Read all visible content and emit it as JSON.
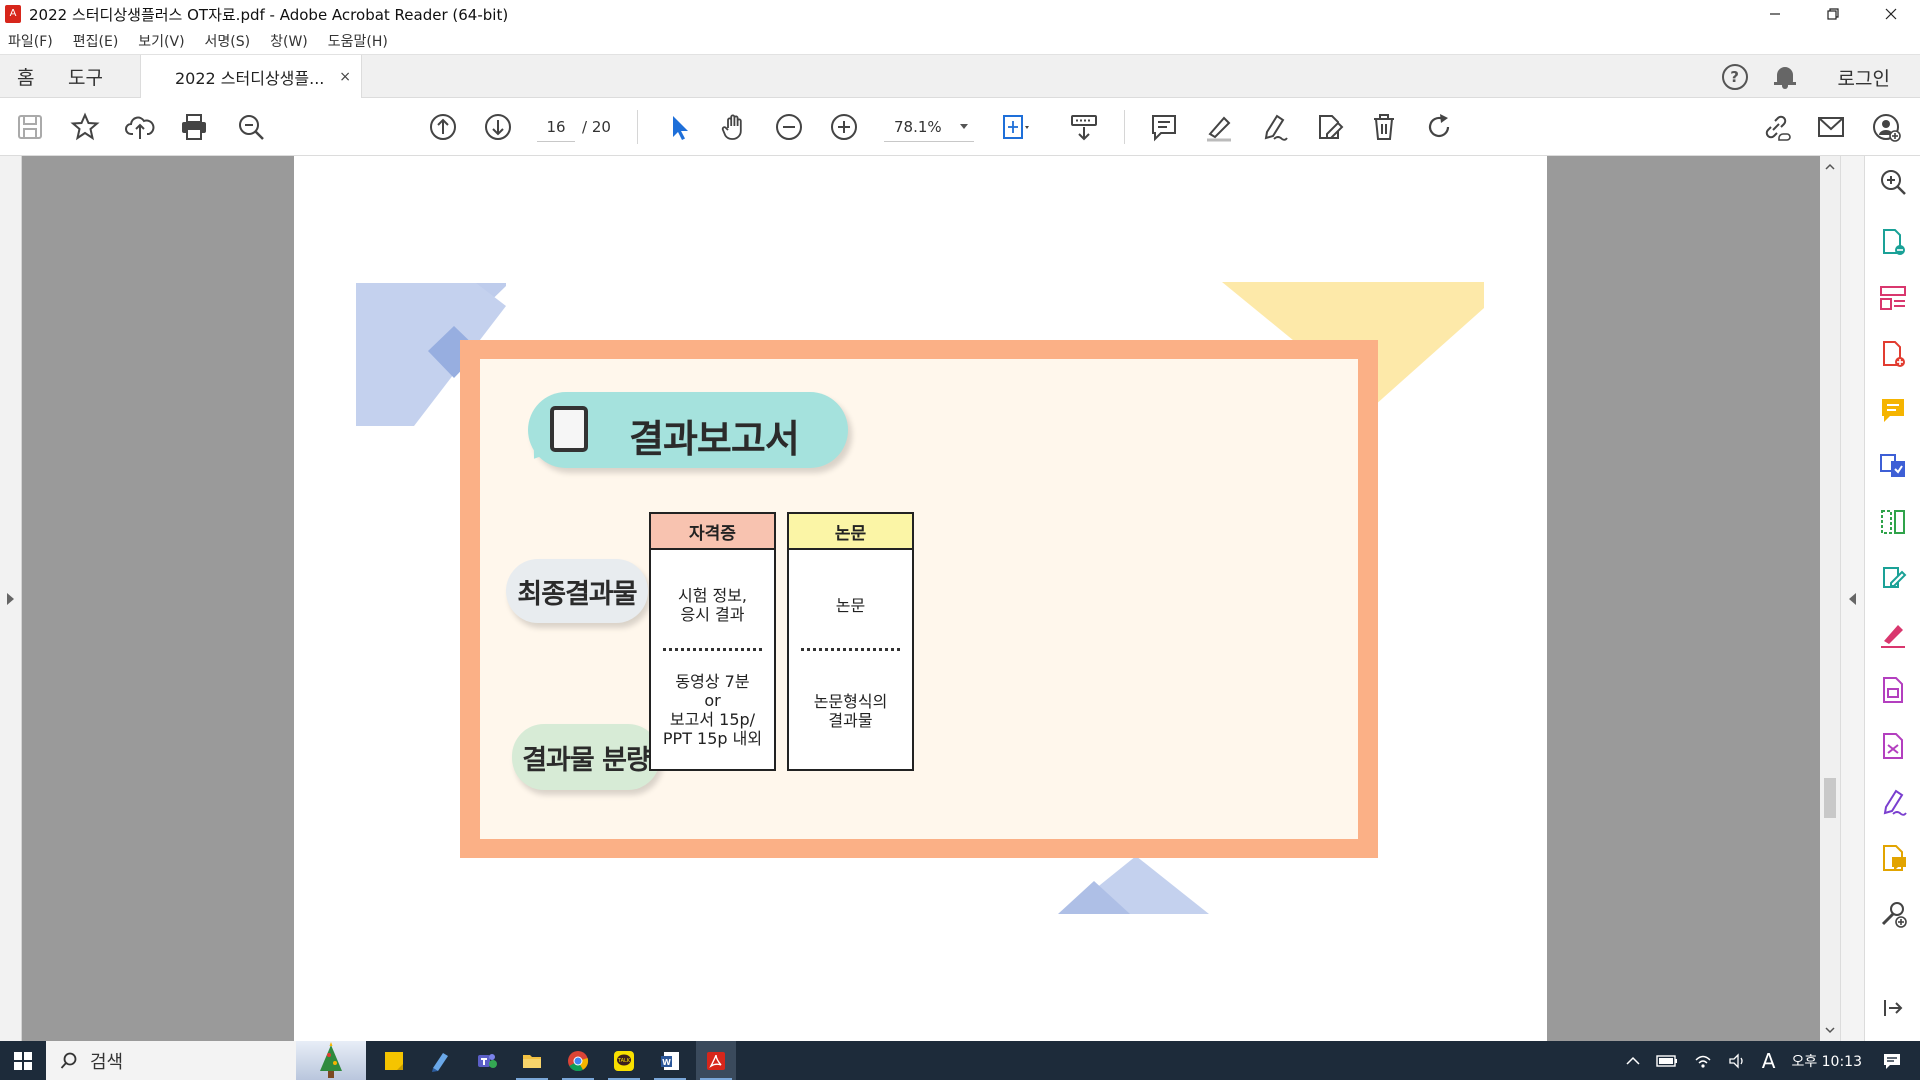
{
  "window": {
    "title": "2022 스터디상생플러스 OT자료.pdf - Adobe Acrobat Reader (64-bit)",
    "app_icon": "pdf-icon",
    "buttons": [
      "minimize",
      "restore",
      "close"
    ]
  },
  "menu": [
    "파일(F)",
    "편집(E)",
    "보기(V)",
    "서명(S)",
    "창(W)",
    "도움말(H)"
  ],
  "tabs": {
    "home": "홈",
    "tools": "도구",
    "document": "2022 스터디상생플...",
    "close": "×",
    "login": "로그인",
    "help": "?"
  },
  "toolbar": {
    "left_icons": [
      "save-icon",
      "star-icon",
      "upload-icon",
      "print-icon",
      "search-zoom-icon"
    ],
    "page_current": "16",
    "page_total": "/ 20",
    "zoom": "78.1%",
    "tool_icons": [
      "select-arrow-icon",
      "hand-icon",
      "zoom-out-icon",
      "zoom-in-icon",
      "fit-page-icon",
      "keyboard-scroll-icon",
      "comment-icon",
      "highlight-icon",
      "sign-icon",
      "edit-pdf-icon",
      "delete-icon",
      "rotate-icon",
      "share-link-icon",
      "email-icon",
      "add-user-icon"
    ]
  },
  "right_panel": {
    "icons": [
      "zoom-icon",
      "export-pdf-icon",
      "organize-pages-icon",
      "create-pdf-icon",
      "comment-icon",
      "combine-files-icon",
      "compress-icon",
      "edit-icon",
      "fill-sign-icon",
      "protect-icon",
      "measure-icon",
      "request-signature-icon",
      "send-comments-icon",
      "more-tools-icon",
      "collapse-icon"
    ]
  },
  "slide": {
    "title": "결과보고서",
    "bubble_final": "최종결과물",
    "bubble_amount": "결과물 분량",
    "col_cert": {
      "head": "자격증",
      "cell1": "시험 정보,\n응시 결과",
      "cell2": "동영상 7분\nor\n보고서 15p/\nPPT 15p 내외"
    },
    "col_paper": {
      "head": "논문",
      "cell1": "논문",
      "cell2": "논문형식의\n결과물"
    },
    "colors": {
      "frame": "#fbb086",
      "inner": "#fff7ec",
      "title_pill": "#a5e2dd",
      "head_cert": "#f8c3b0",
      "head_paper": "#fbf5a6"
    }
  },
  "taskbar": {
    "search_label": "검색",
    "apps": [
      "sticky-notes-icon",
      "notes-icon",
      "teams-icon",
      "file-explorer-icon",
      "chrome-icon",
      "kakaotalk-icon",
      "word-icon",
      "acrobat-icon"
    ],
    "tray_ime": "A",
    "clock": "오후 10:13"
  }
}
